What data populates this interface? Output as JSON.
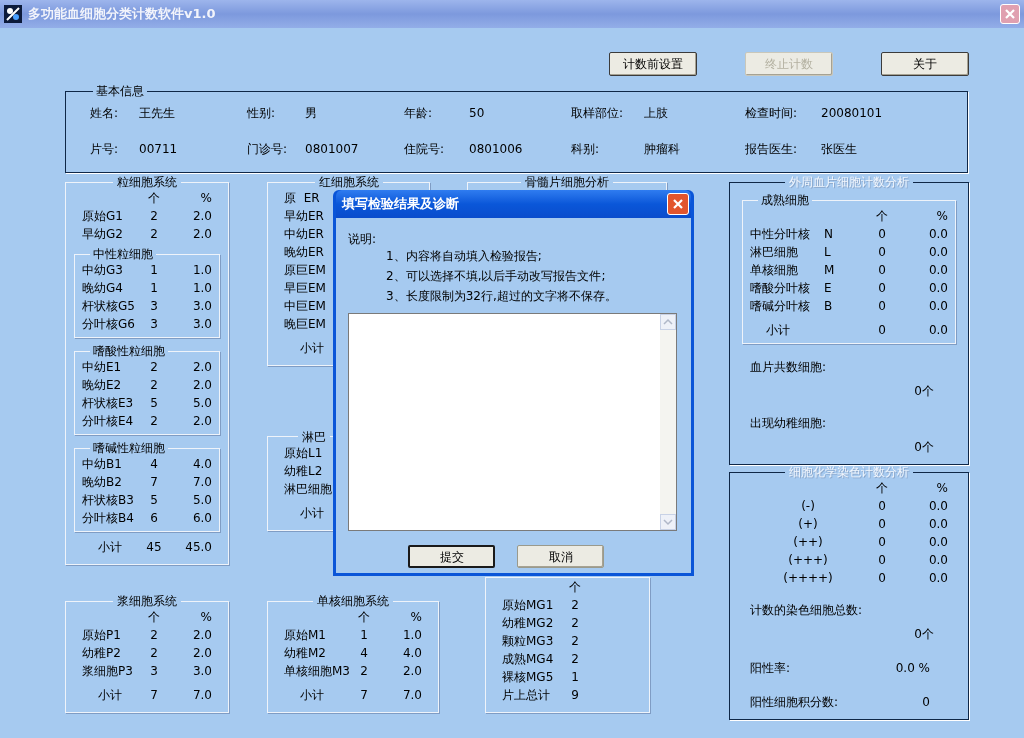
{
  "window": {
    "title": "多功能血细胞分类计数软件v1.0"
  },
  "toolbar": [
    {
      "label": "计数前设置",
      "disabled": false
    },
    {
      "label": "终止计数",
      "disabled": true
    },
    {
      "label": "关于",
      "disabled": false
    }
  ],
  "basic_info": {
    "title": "基本信息",
    "fields": [
      {
        "label": "姓名:",
        "value": "王先生"
      },
      {
        "label": "性别:",
        "value": "男"
      },
      {
        "label": "年龄:",
        "value": "50"
      },
      {
        "label": "取样部位:",
        "value": "上肢"
      },
      {
        "label": "检查时间:",
        "value": "20080101"
      },
      {
        "label": "片号:",
        "value": "00711"
      },
      {
        "label": "门诊号:",
        "value": "0801007"
      },
      {
        "label": "住院号:",
        "value": "0801006"
      },
      {
        "label": "科别:",
        "value": "肿瘤科"
      },
      {
        "label": "报告医生:",
        "value": "张医生"
      }
    ]
  },
  "columns": [
    {
      "groups": [
        {
          "title": "粒细胞系统",
          "disabled": false,
          "items": [
            {
              "kind": "header",
              "cells": [
                "个",
                "%"
              ]
            },
            {
              "kind": "row",
              "label": "原始G1",
              "count": "2",
              "percent": "2.0"
            },
            {
              "kind": "row",
              "label": "早幼G2",
              "count": "2",
              "percent": "2.0"
            },
            {
              "kind": "subgroup",
              "title": "中性粒细胞",
              "items": [
                {
                  "kind": "row",
                  "label": "中幼G3",
                  "count": "1",
                  "percent": "1.0"
                },
                {
                  "kind": "row",
                  "label": "晚幼G4",
                  "count": "1",
                  "percent": "1.0"
                },
                {
                  "kind": "row",
                  "label": "杆状核G5",
                  "count": "3",
                  "percent": "3.0"
                },
                {
                  "kind": "row",
                  "label": "分叶核G6",
                  "count": "3",
                  "percent": "3.0"
                }
              ]
            },
            {
              "kind": "subgroup",
              "title": "嗜酸性粒细胞",
              "items": [
                {
                  "kind": "row",
                  "label": "中幼E1",
                  "count": "2",
                  "percent": "2.0"
                },
                {
                  "kind": "row",
                  "label": "晚幼E2",
                  "count": "2",
                  "percent": "2.0"
                },
                {
                  "kind": "row",
                  "label": "杆状核E3",
                  "count": "5",
                  "percent": "5.0"
                },
                {
                  "kind": "row",
                  "label": "分叶核E4",
                  "count": "2",
                  "percent": "2.0"
                }
              ]
            },
            {
              "kind": "subgroup",
              "title": "嗜碱性粒细胞",
              "items": [
                {
                  "kind": "row",
                  "label": "中幼B1",
                  "count": "4",
                  "percent": "4.0"
                },
                {
                  "kind": "row",
                  "label": "晚幼B2",
                  "count": "7",
                  "percent": "7.0"
                },
                {
                  "kind": "row",
                  "label": "杆状核B3",
                  "count": "5",
                  "percent": "5.0"
                },
                {
                  "kind": "row",
                  "label": "分叶核B4",
                  "count": "6",
                  "percent": "6.0"
                }
              ]
            },
            {
              "kind": "total",
              "label": "小计",
              "count": "45",
              "percent": "45.0"
            }
          ]
        },
        {
          "title": "浆细胞系统",
          "disabled": false,
          "items": [
            {
              "kind": "header",
              "cells": [
                "个",
                "%"
              ]
            },
            {
              "kind": "row",
              "label": "原始P1",
              "count": "2",
              "percent": "2.0"
            },
            {
              "kind": "row",
              "label": "幼稚P2",
              "count": "2",
              "percent": "2.0"
            },
            {
              "kind": "row",
              "label": "浆细胞P3",
              "count": "3",
              "percent": "3.0"
            },
            {
              "kind": "total",
              "label": "小计",
              "count": "7",
              "percent": "7.0"
            }
          ]
        }
      ]
    },
    {
      "groups": [
        {
          "title": "红细胞系统",
          "disabled": false,
          "items": [
            {
              "kind": "row",
              "label": "原  ER"
            },
            {
              "kind": "row",
              "label": "早幼ER"
            },
            {
              "kind": "row",
              "label": "中幼ER"
            },
            {
              "kind": "row",
              "label": "晚幼ER"
            },
            {
              "kind": "row",
              "label": "原巨EM"
            },
            {
              "kind": "row",
              "label": "早巨EM"
            },
            {
              "kind": "row",
              "label": "中巨EM"
            },
            {
              "kind": "row",
              "label": "晚巨EM"
            },
            {
              "kind": "total",
              "label": "小计"
            }
          ]
        },
        {
          "title": "淋巴",
          "disabled": false,
          "items": [
            {
              "kind": "row",
              "label": "原始L1"
            },
            {
              "kind": "row",
              "label": "幼稚L2"
            },
            {
              "kind": "row",
              "label": "淋巴细胞"
            },
            {
              "kind": "total",
              "label": "小计"
            }
          ]
        },
        {
          "title": "单核细胞系统",
          "disabled": false,
          "items": [
            {
              "kind": "header",
              "cells": [
                "个",
                "%"
              ]
            },
            {
              "kind": "row",
              "label": "原始M1",
              "count": "1",
              "percent": "1.0"
            },
            {
              "kind": "row",
              "label": "幼稚M2",
              "count": "4",
              "percent": "4.0"
            },
            {
              "kind": "row",
              "label": "单核细胞M3",
              "count": "2",
              "percent": "2.0"
            },
            {
              "kind": "total",
              "label": "小计",
              "count": "7",
              "percent": "7.0"
            }
          ]
        }
      ]
    },
    {
      "groups": [
        {
          "title": "骨髓片细胞分析",
          "disabled": false
        },
        {
          "disabled": false,
          "items": [
            {
              "kind": "header",
              "cells": [
                "个"
              ]
            },
            {
              "kind": "row",
              "label": "原始MG1",
              "count": "2"
            },
            {
              "kind": "row",
              "label": "幼稚MG2",
              "count": "2"
            },
            {
              "kind": "row",
              "label": "颗粒MG3",
              "count": "2"
            },
            {
              "kind": "row",
              "label": "成熟MG4",
              "count": "2"
            },
            {
              "kind": "row",
              "label": "裸核MG5",
              "count": "1"
            },
            {
              "kind": "row",
              "label": "片上总计",
              "count": "9"
            }
          ]
        }
      ]
    },
    {
      "groups": [
        {
          "title": "外周血片细胞计数分析",
          "disabled": true,
          "items": [
            {
              "kind": "subgroup",
              "title": "成熟细胞",
              "items": [
                {
                  "kind": "header",
                  "cells": [
                    "个",
                    "%"
                  ]
                },
                {
                  "kind": "row",
                  "label": "中性分叶核",
                  "code": "N",
                  "count": "0",
                  "percent": "0.0"
                },
                {
                  "kind": "row",
                  "label": "淋巴细胞",
                  "code": "L",
                  "count": "0",
                  "percent": "0.0"
                },
                {
                  "kind": "row",
                  "label": "单核细胞",
                  "code": "M",
                  "count": "0",
                  "percent": "0.0"
                },
                {
                  "kind": "row",
                  "label": "嗜酸分叶核",
                  "code": "E",
                  "count": "0",
                  "percent": "0.0"
                },
                {
                  "kind": "row",
                  "label": "嗜碱分叶核",
                  "code": "B",
                  "count": "0",
                  "percent": "0.0"
                },
                {
                  "kind": "total",
                  "label": "小计",
                  "count": "0",
                  "percent": "0.0"
                }
              ]
            },
            {
              "kind": "note",
              "label": "血片共数细胞:",
              "value": "0个"
            },
            {
              "kind": "note",
              "label": "出现幼稚细胞:",
              "value": "0个"
            }
          ]
        },
        {
          "title": "细胞化学染色计数分析",
          "disabled": true,
          "items": [
            {
              "kind": "header",
              "cells": [
                "个",
                "%"
              ]
            },
            {
              "kind": "grade",
              "label": "(-)",
              "count": "0",
              "percent": "0.0"
            },
            {
              "kind": "grade",
              "label": "(+)",
              "count": "0",
              "percent": "0.0"
            },
            {
              "kind": "grade",
              "label": "(++)",
              "count": "0",
              "percent": "0.0"
            },
            {
              "kind": "grade",
              "label": "(+++)",
              "count": "0",
              "percent": "0.0"
            },
            {
              "kind": "grade",
              "label": "(++++)",
              "count": "0",
              "percent": "0.0"
            },
            {
              "kind": "note",
              "label": "计数的染色细胞总数:",
              "value": "0个"
            },
            {
              "kind": "note_inline",
              "label": "阳性率:",
              "value": "0.0 %"
            },
            {
              "kind": "note_inline",
              "label": "阳性细胞积分数:",
              "value": "0"
            }
          ]
        }
      ]
    }
  ],
  "dialog": {
    "title": "填写检验结果及诊断",
    "intro": "说明:",
    "lines": [
      "1、内容将自动填入检验报告;",
      "2、可以选择不填,以后手动改写报告文件;",
      "3、长度限制为32行,超过的文字将不保存。"
    ],
    "buttons": [
      {
        "label": "提交",
        "focused": true
      },
      {
        "label": "取消",
        "focused": false
      }
    ]
  }
}
